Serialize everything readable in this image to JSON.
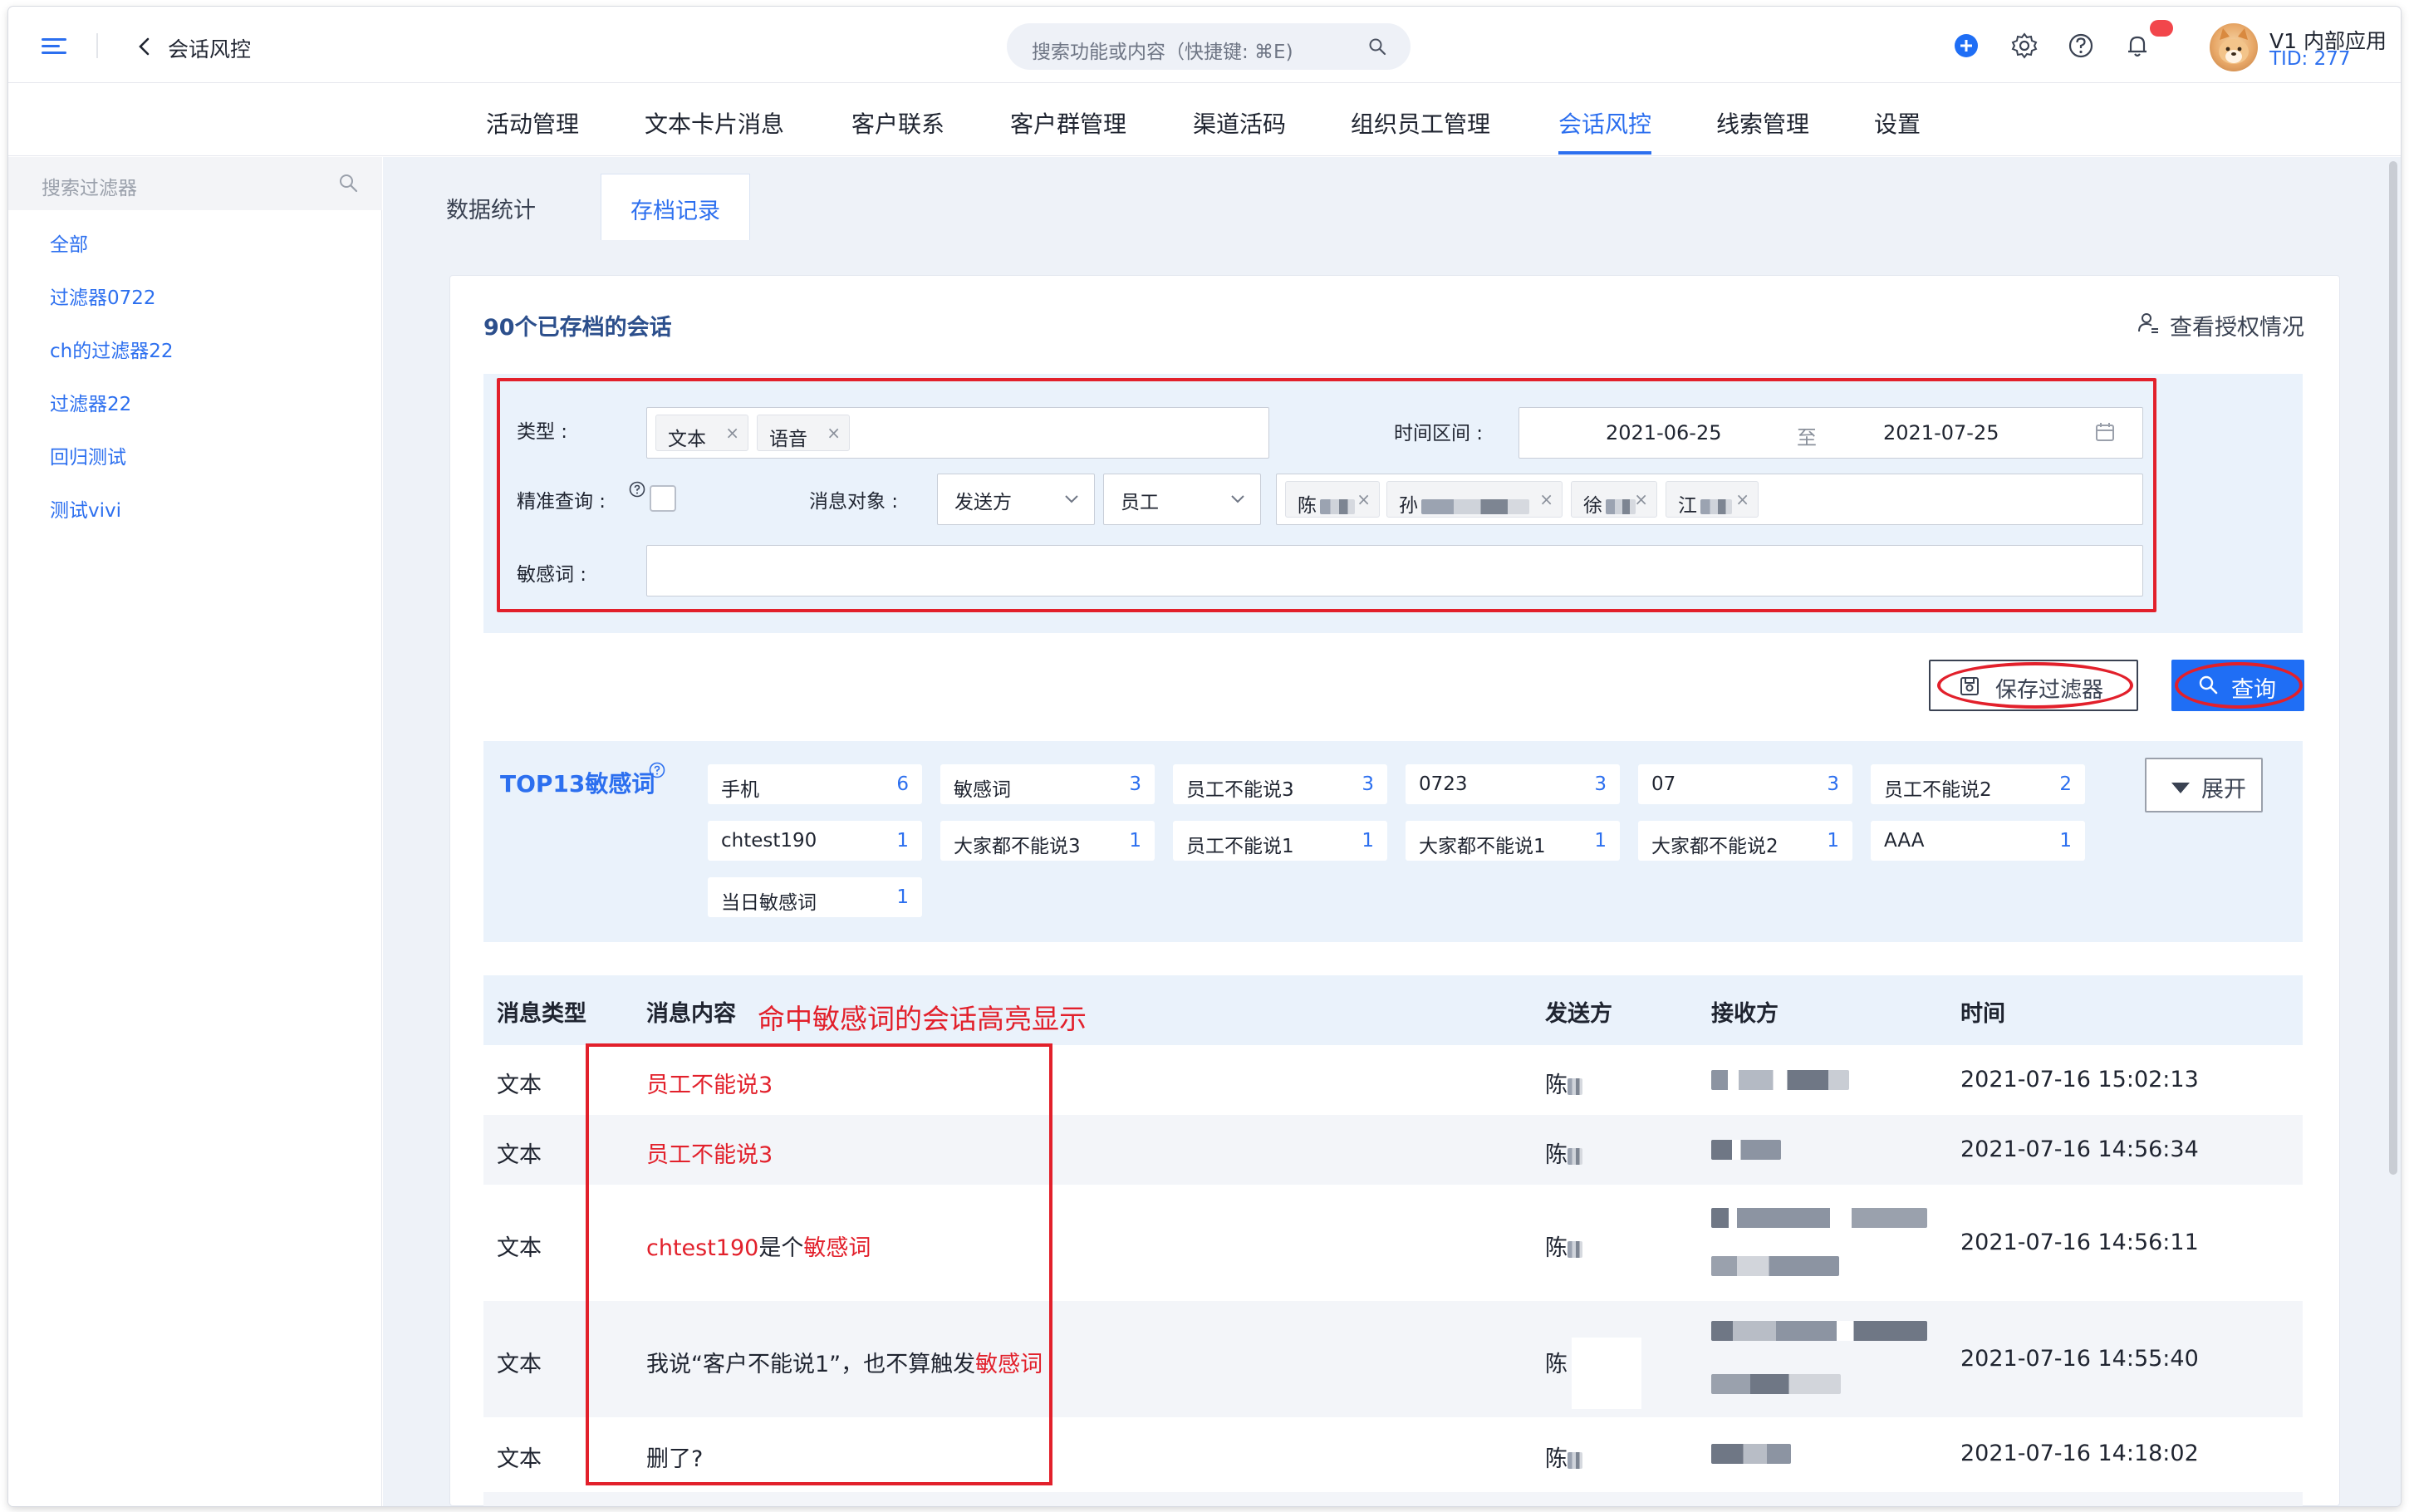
{
  "header": {
    "back_title": "会话风控",
    "search_placeholder": "搜索功能或内容（快捷键: ⌘E)",
    "user_name": "V1 内部应用",
    "user_tid": "TID: 277"
  },
  "nav": {
    "items": [
      {
        "label": "活动管理"
      },
      {
        "label": "文本卡片消息"
      },
      {
        "label": "客户联系"
      },
      {
        "label": "客户群管理"
      },
      {
        "label": "渠道活码"
      },
      {
        "label": "组织员工管理"
      },
      {
        "label": "会话风控",
        "active": true
      },
      {
        "label": "线索管理"
      },
      {
        "label": "设置"
      }
    ]
  },
  "sidebar": {
    "search_placeholder": "搜索过滤器",
    "items": [
      {
        "label": "全部"
      },
      {
        "label": "过滤器0722"
      },
      {
        "label": "ch的过滤器22"
      },
      {
        "label": "过滤器22"
      },
      {
        "label": "回归测试"
      },
      {
        "label": "测试vivi"
      }
    ]
  },
  "tabs": [
    {
      "label": "数据统计",
      "active": false
    },
    {
      "label": "存档记录",
      "active": true
    }
  ],
  "card": {
    "title": "90个已存档的会话",
    "auth_link": "查看授权情况"
  },
  "filters": {
    "type_label": "类型 :",
    "type_tags": [
      "文本",
      "语音"
    ],
    "time_label": "时间区间 :",
    "date_start": "2021-06-25",
    "date_sep": "至",
    "date_end": "2021-07-25",
    "exact_label": "精准查询 :",
    "target_label": "消息对象 :",
    "target_role": "发送方",
    "target_group": "员工",
    "target_people": [
      "陈",
      "孙",
      "徐",
      "江"
    ],
    "sensitive_label": "敏感词 :",
    "sensitive_value": ""
  },
  "actions": {
    "save_filter": "保存过滤器",
    "query": "查询"
  },
  "top_words": {
    "title": "TOP13敏感词",
    "expand": "展开",
    "items": [
      {
        "word": "手机",
        "count": "6"
      },
      {
        "word": "敏感词",
        "count": "3"
      },
      {
        "word": "员工不能说3",
        "count": "3"
      },
      {
        "word": "0723",
        "count": "3"
      },
      {
        "word": "07",
        "count": "3"
      },
      {
        "word": "员工不能说2",
        "count": "2"
      },
      {
        "word": "chtest190",
        "count": "1"
      },
      {
        "word": "大家都不能说3",
        "count": "1"
      },
      {
        "word": "员工不能说1",
        "count": "1"
      },
      {
        "word": "大家都不能说1",
        "count": "1"
      },
      {
        "word": "大家都不能说2",
        "count": "1"
      },
      {
        "word": "AAA",
        "count": "1"
      },
      {
        "word": "当日敏感词",
        "count": "1"
      }
    ]
  },
  "table": {
    "headers": {
      "type": "消息类型",
      "content": "消息内容",
      "sender": "发送方",
      "receiver": "接收方",
      "time": "时间"
    },
    "annotation": "命中敏感词的会话高亮显示",
    "rows": [
      {
        "type": "文本",
        "c1": "员工不能说3",
        "c1_hl": true,
        "c2": "",
        "c3": "",
        "sender": "陈",
        "time": "2021-07-16 15:02:13"
      },
      {
        "type": "文本",
        "c1": "员工不能说3",
        "c1_hl": true,
        "c2": "",
        "c3": "",
        "sender": "陈",
        "time": "2021-07-16 14:56:34"
      },
      {
        "type": "文本",
        "c1": "chtest190",
        "c1_hl": true,
        "c2": "是个",
        "c3": "敏感词",
        "sender": "陈",
        "time": "2021-07-16 14:56:11"
      },
      {
        "type": "文本",
        "c1": "我说“客户不能说1”，也不算触发",
        "c1_hl": false,
        "c2": "",
        "c3": "敏感词",
        "sender": "陈",
        "time": "2021-07-16 14:55:40"
      },
      {
        "type": "文本",
        "c1": "删了?",
        "c1_hl": false,
        "c2": "",
        "c3": "",
        "sender": "陈",
        "time": "2021-07-16 14:18:02"
      }
    ]
  },
  "colors": {
    "accent": "#2c6fef",
    "highlight": "#e2202b",
    "panel": "#eaf2fb"
  }
}
